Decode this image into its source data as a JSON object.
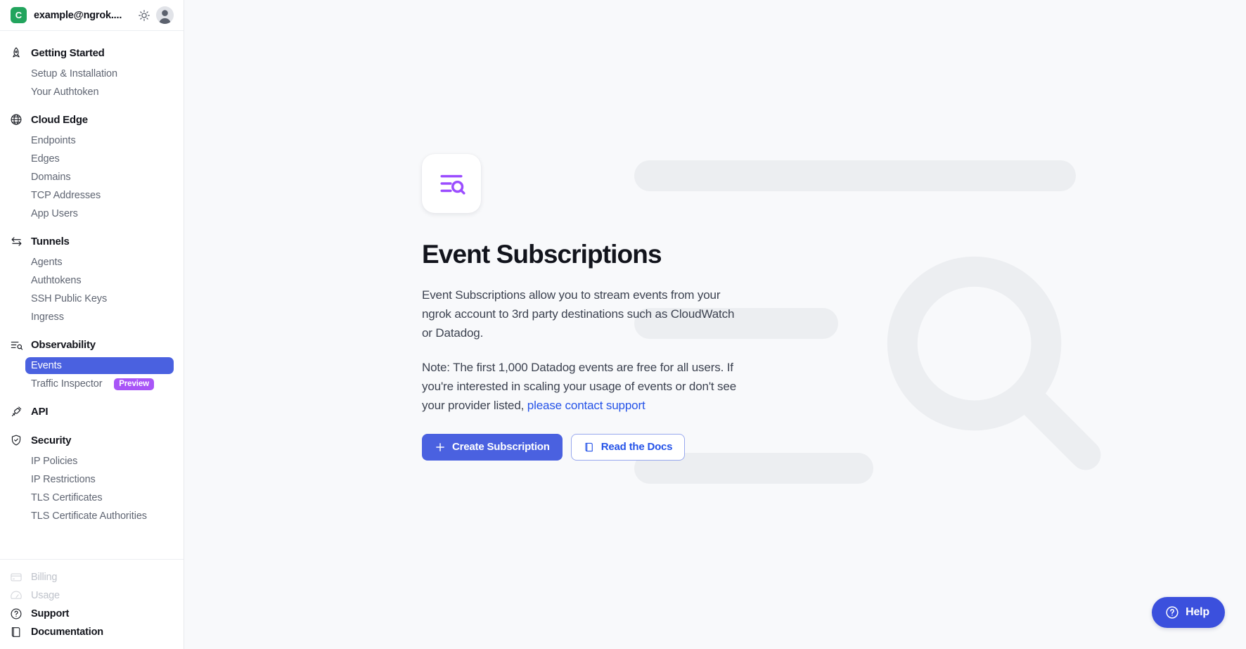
{
  "sidebar": {
    "account": {
      "initial": "C",
      "name": "example@ngrok....",
      "theme_toggle_icon": "sun-icon",
      "avatar_icon": "avatar-icon"
    },
    "groups": [
      {
        "label": "Getting Started",
        "icon": "rocket-icon",
        "items": [
          {
            "label": "Setup & Installation"
          },
          {
            "label": "Your Authtoken"
          }
        ]
      },
      {
        "label": "Cloud Edge",
        "icon": "globe-icon",
        "items": [
          {
            "label": "Endpoints"
          },
          {
            "label": "Edges"
          },
          {
            "label": "Domains"
          },
          {
            "label": "TCP Addresses"
          },
          {
            "label": "App Users"
          }
        ]
      },
      {
        "label": "Tunnels",
        "icon": "tunnels-icon",
        "items": [
          {
            "label": "Agents"
          },
          {
            "label": "Authtokens"
          },
          {
            "label": "SSH Public Keys"
          },
          {
            "label": "Ingress"
          }
        ]
      },
      {
        "label": "Observability",
        "icon": "observability-icon",
        "items": [
          {
            "label": "Events",
            "active": true
          },
          {
            "label": "Traffic Inspector",
            "badge": "Preview"
          }
        ]
      },
      {
        "label": "API",
        "icon": "api-plug-icon",
        "items": []
      },
      {
        "label": "Security",
        "icon": "shield-check-icon",
        "items": [
          {
            "label": "IP Policies"
          },
          {
            "label": "IP Restrictions"
          },
          {
            "label": "TLS Certificates"
          },
          {
            "label": "TLS Certificate Authorities"
          }
        ]
      }
    ],
    "bottom": [
      {
        "label": "Billing",
        "icon": "credit-card-icon",
        "muted": true
      },
      {
        "label": "Usage",
        "icon": "gauge-icon",
        "muted": true
      },
      {
        "label": "Support",
        "icon": "question-circle-icon",
        "muted": false
      },
      {
        "label": "Documentation",
        "icon": "book-icon",
        "muted": false
      }
    ]
  },
  "main": {
    "hero_icon": "event-subscriptions-icon",
    "title": "Event Subscriptions",
    "paragraph_1": "Event Subscriptions allow you to stream events from your ngrok account to 3rd party destinations such as CloudWatch or Datadog.",
    "paragraph_2_before": "Note: The first 1,000 Datadog events are free for all users. If you're interested in scaling your usage of events or don't see your provider listed, ",
    "paragraph_2_link": "please contact support",
    "buttons": {
      "create_label": "Create Subscription",
      "create_icon": "plus-icon",
      "docs_label": "Read the Docs",
      "docs_icon": "book-icon"
    },
    "watermark_icon": "magnifier-watermark-icon"
  },
  "help": {
    "label": "Help",
    "icon": "question-circle-icon"
  },
  "colors": {
    "accent_blue": "#4a61e0",
    "link_blue": "#2553e8",
    "badge_purple": "#a855f7",
    "account_green": "#22a45d",
    "hero_purple": "#9b4dff",
    "skeleton_gray": "#eceef1",
    "page_bg": "#f8f9fb"
  }
}
